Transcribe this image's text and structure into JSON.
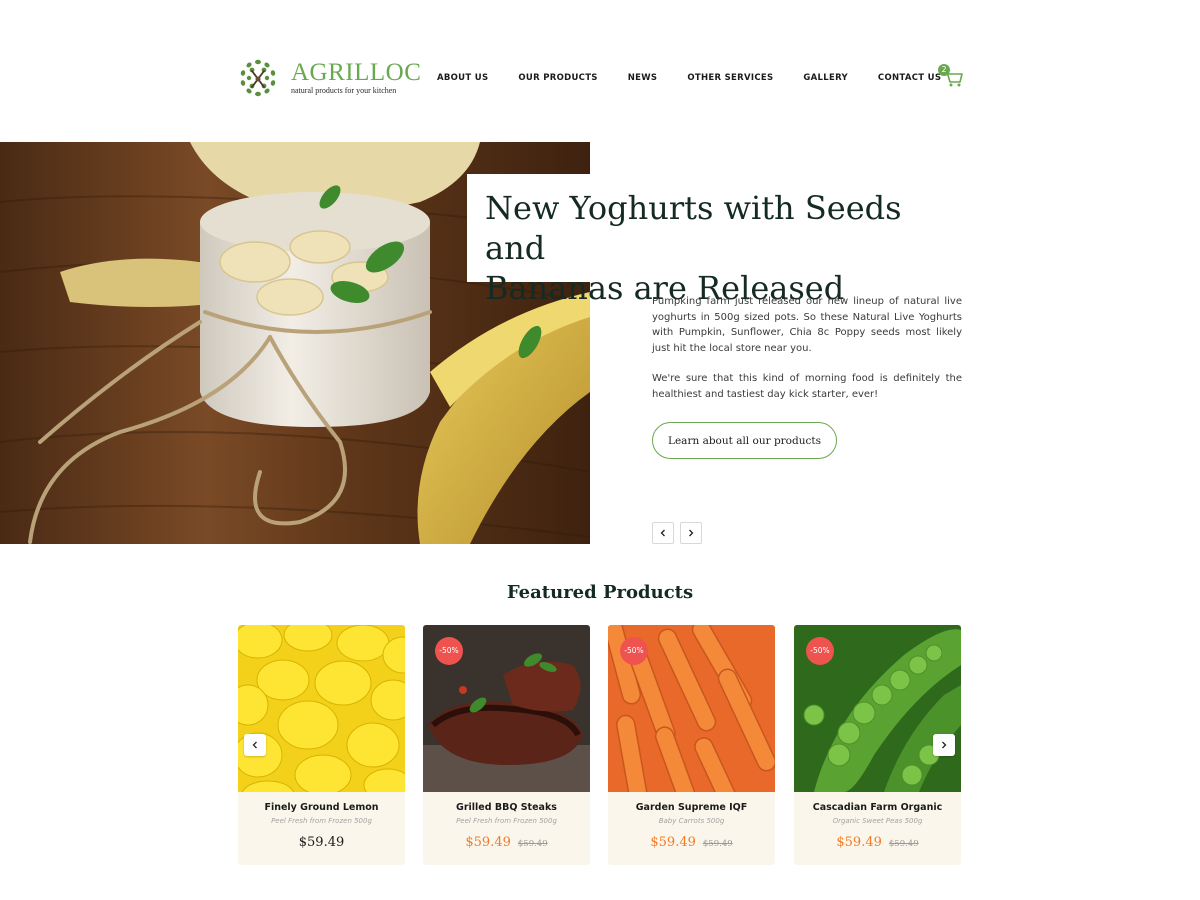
{
  "header": {
    "brand": "AGRILLOC",
    "tagline": "natural products for your kitchen",
    "nav": [
      "ABOUT US",
      "OUR PRODUCTS",
      "NEWS",
      "OTHER SERVICES",
      "GALLERY",
      "CONTACT US"
    ],
    "cart_count": "2",
    "icons": {
      "logo": "leaf-fork-logo",
      "cart": "shopping-cart-icon"
    }
  },
  "hero": {
    "title_line1": "New Yoghurts with Seeds and",
    "title_line2": "Bananas are Released",
    "paragraph1": "Pumpking farm just released our new lineup of natural live yoghurts in 500g sized pots. So these Natural Live Yoghurts with Pumpkin, Sunflower, Chia 8c Poppy seeds most likely just hit the local store near you.",
    "paragraph2": "We're sure that this kind of morning food is definitely the healthiest and tastiest day kick starter, ever!",
    "button_label": "Learn about all our products",
    "icons": {
      "prev": "chevron-left-icon",
      "next": "chevron-right-icon"
    }
  },
  "featured": {
    "title": "Featured Products",
    "products": [
      {
        "name": "Finely Ground Lemon",
        "sub": "Peel Fresh from Frozen 500g",
        "price": "$59.49",
        "old_price": "",
        "badge": ""
      },
      {
        "name": "Grilled BBQ Steaks",
        "sub": "Peel Fresh from Frozen 500g",
        "price": "$59.49",
        "old_price": "$59.49",
        "badge": "-50%"
      },
      {
        "name": "Garden Supreme IQF",
        "sub": "Baby Carrots 500g",
        "price": "$59.49",
        "old_price": "$59.49",
        "badge": "-50%"
      },
      {
        "name": "Cascadian Farm Organic",
        "sub": "Organic Sweet Peas 500g",
        "price": "$59.49",
        "old_price": "$59.49",
        "badge": "-50%"
      }
    ]
  },
  "colors": {
    "accent_green": "#6aa84f",
    "price_orange": "#f07b2a",
    "badge_red": "#ef5350",
    "card_bg": "#faf6ec"
  }
}
